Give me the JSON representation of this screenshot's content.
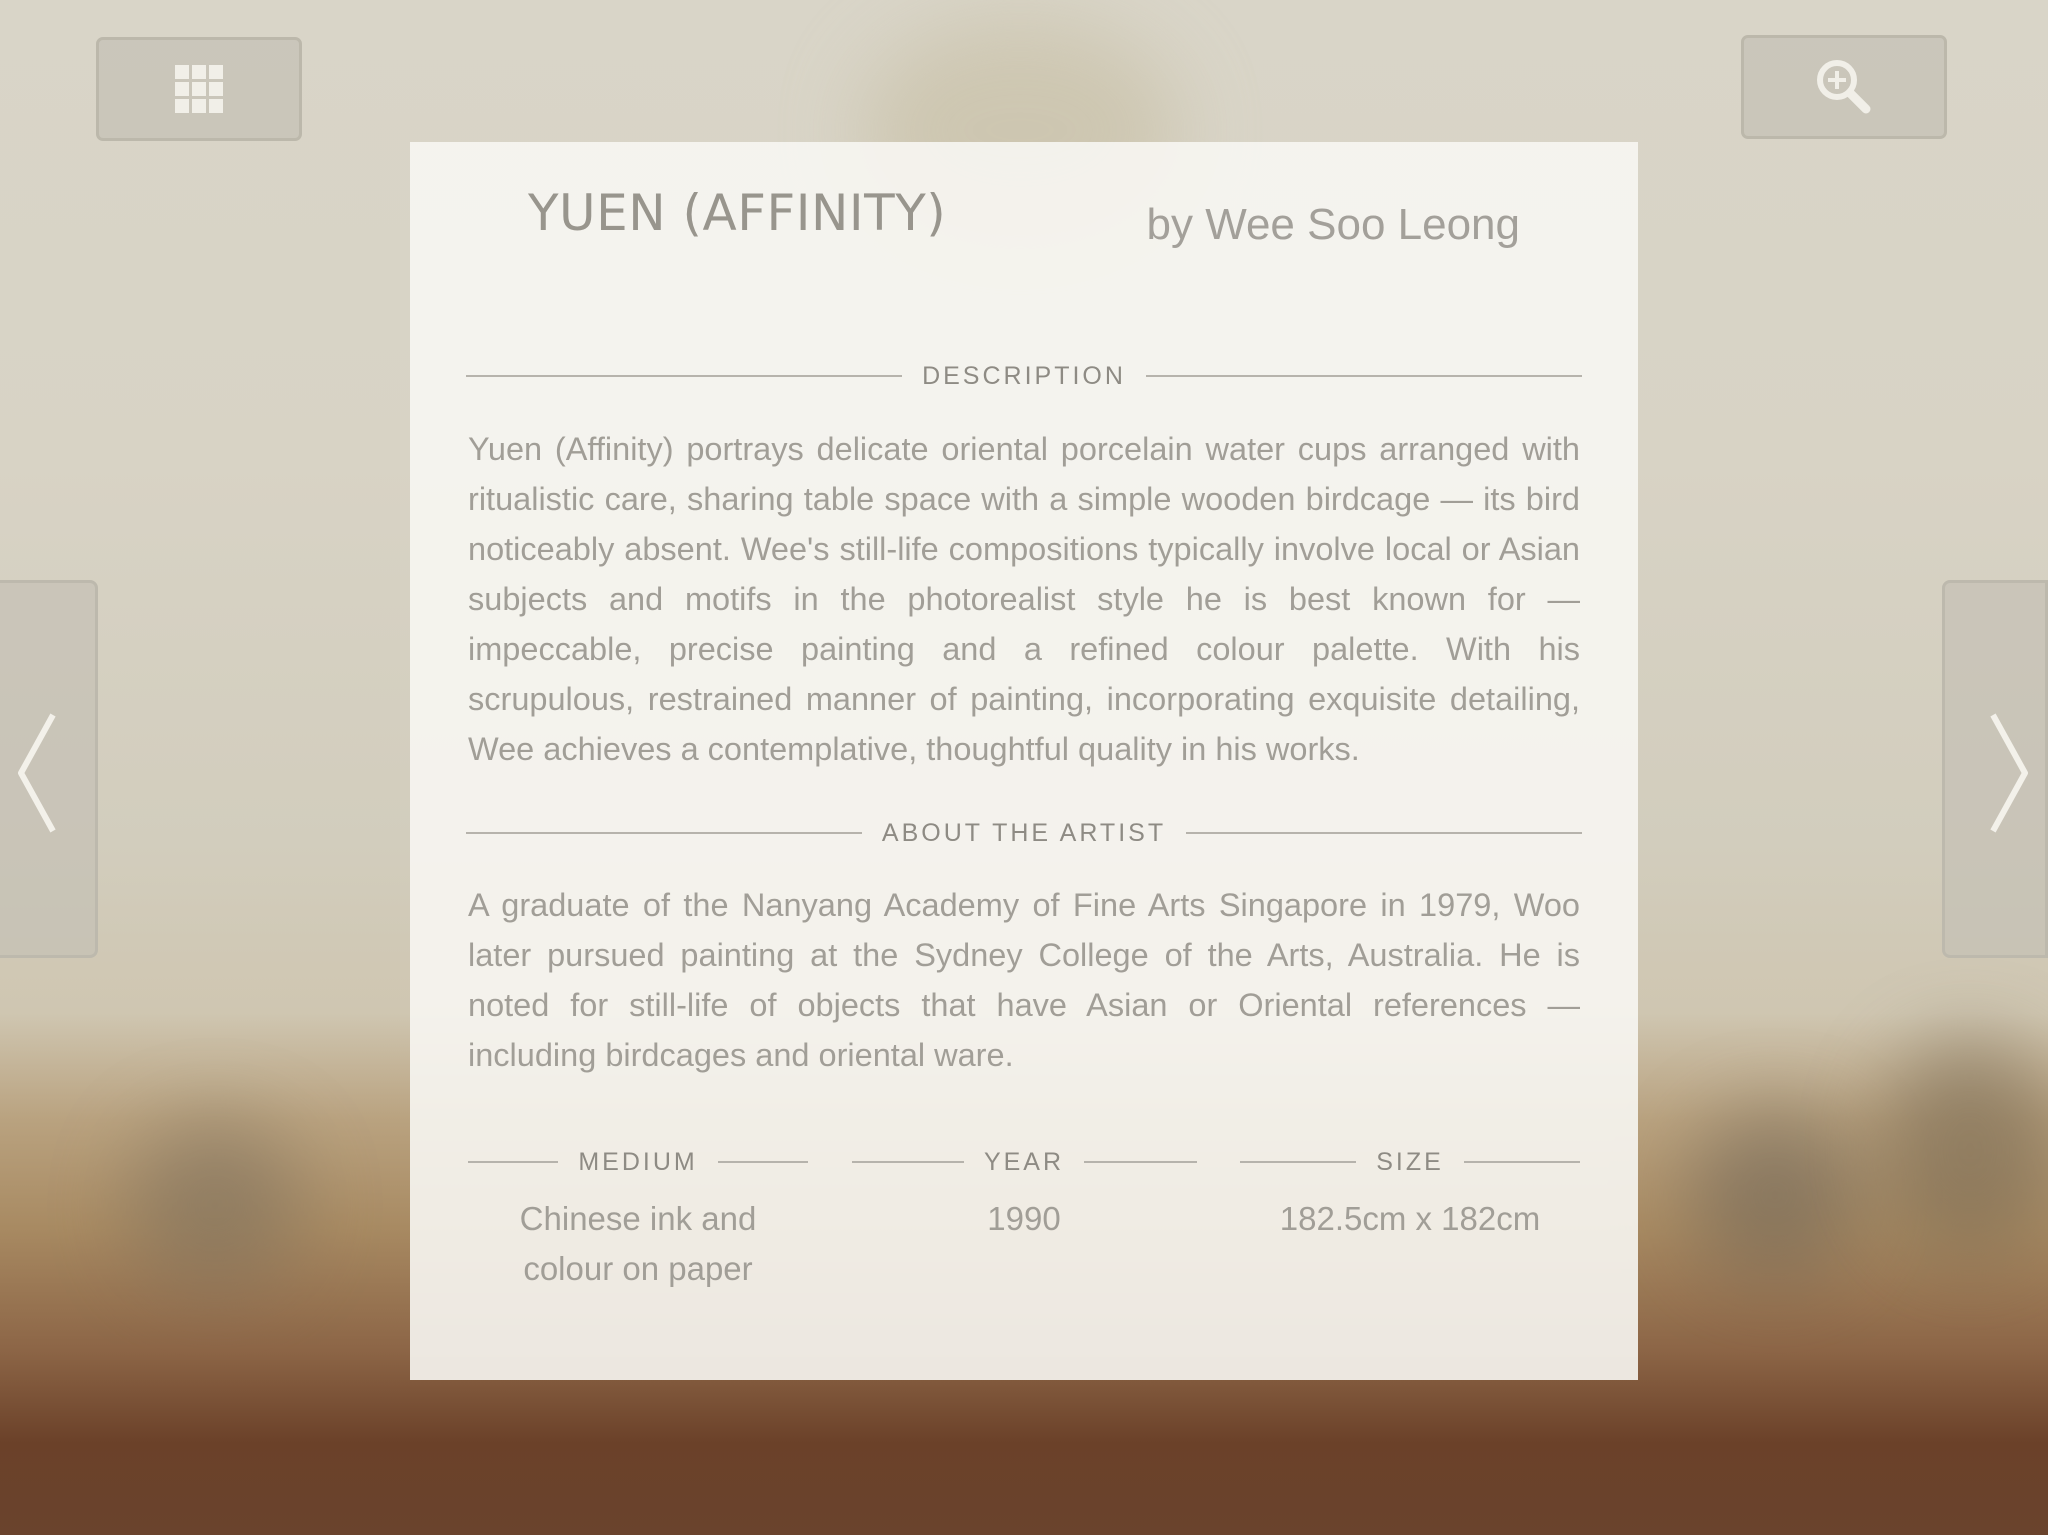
{
  "toolbar": {
    "grid_icon": "grid-icon",
    "zoom_icon": "zoom-in-icon"
  },
  "navigation": {
    "prev_icon": "chevron-left-icon",
    "next_icon": "chevron-right-icon"
  },
  "artwork": {
    "title": "YUEN (AFFINITY)",
    "artist": "by Wee Soo Leong",
    "description_heading": "DESCRIPTION",
    "description": "Yuen (Affinity) portrays delicate oriental porcelain water cups arranged with ritualistic care, sharing table space with a simple wooden birdcage — its bird noticeably absent. Wee's still-life compositions typically involve local or Asian subjects and motifs in the photorealist style he is best known for — impeccable, precise painting and a refined colour palette. With his scrupulous, restrained manner of painting, incorporating exquisite detailing, Wee achieves a contemplative, thoughtful quality in his works.",
    "about_heading": "ABOUT THE ARTIST",
    "about": "A graduate of the Nanyang Academy of Fine Arts Singapore in 1979, Woo later pursued painting at the Sydney College of the Arts, Australia. He is noted for still-life of objects that have Asian or Oriental references — including birdcages and oriental ware.",
    "medium_label": "MEDIUM",
    "medium": "Chinese ink and colour on paper",
    "year_label": "YEAR",
    "year": "1990",
    "size_label": "SIZE",
    "size": "182.5cm x 182cm"
  },
  "colors": {
    "panel_background": "#f7f6f2",
    "text": "#a19e97",
    "rule": "#b6b3ac",
    "button_border": "#bcb8ab"
  }
}
